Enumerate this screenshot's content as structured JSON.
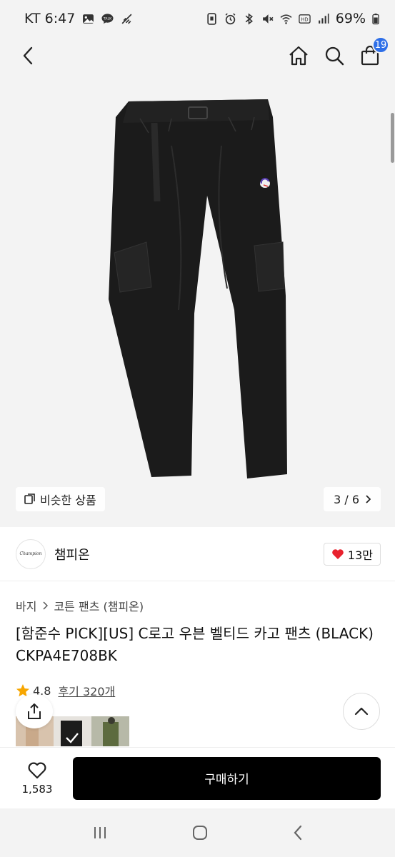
{
  "status_bar": {
    "carrier_time": "KT 6:47",
    "battery": "69%",
    "left_icons": [
      "gallery-icon",
      "talk-icon",
      "signal-off-icon"
    ],
    "right_icons": [
      "save-icon",
      "alarm-icon",
      "bluetooth-icon",
      "mute-icon",
      "wifi-icon",
      "hd-icon",
      "cell-signal-icon",
      "battery-icon"
    ]
  },
  "nav": {
    "cart_count": "19"
  },
  "gallery": {
    "similar_label": "비슷한 상품",
    "counter": "3 / 6",
    "image_progress": 0.5
  },
  "brand": {
    "logo_text": "Champion",
    "name": "챔피온",
    "like_count": "13만"
  },
  "breadcrumb": {
    "items": [
      "바지",
      "코튼 팬츠 (챔피온)"
    ]
  },
  "product": {
    "title": "[함준수 PICK][US] C로고 우븐 벨티드 카고 팬츠 (BLACK) CKPA4E708BK",
    "rating": "4.8",
    "reviews": "후기 320개"
  },
  "bottom": {
    "wish_count": "1,583",
    "buy_label": "구매하기"
  },
  "colors": {
    "accent_badge": "#2e6fe8",
    "heart": "#e8222e",
    "star": "#f7a600",
    "buy_button": "#000000"
  }
}
